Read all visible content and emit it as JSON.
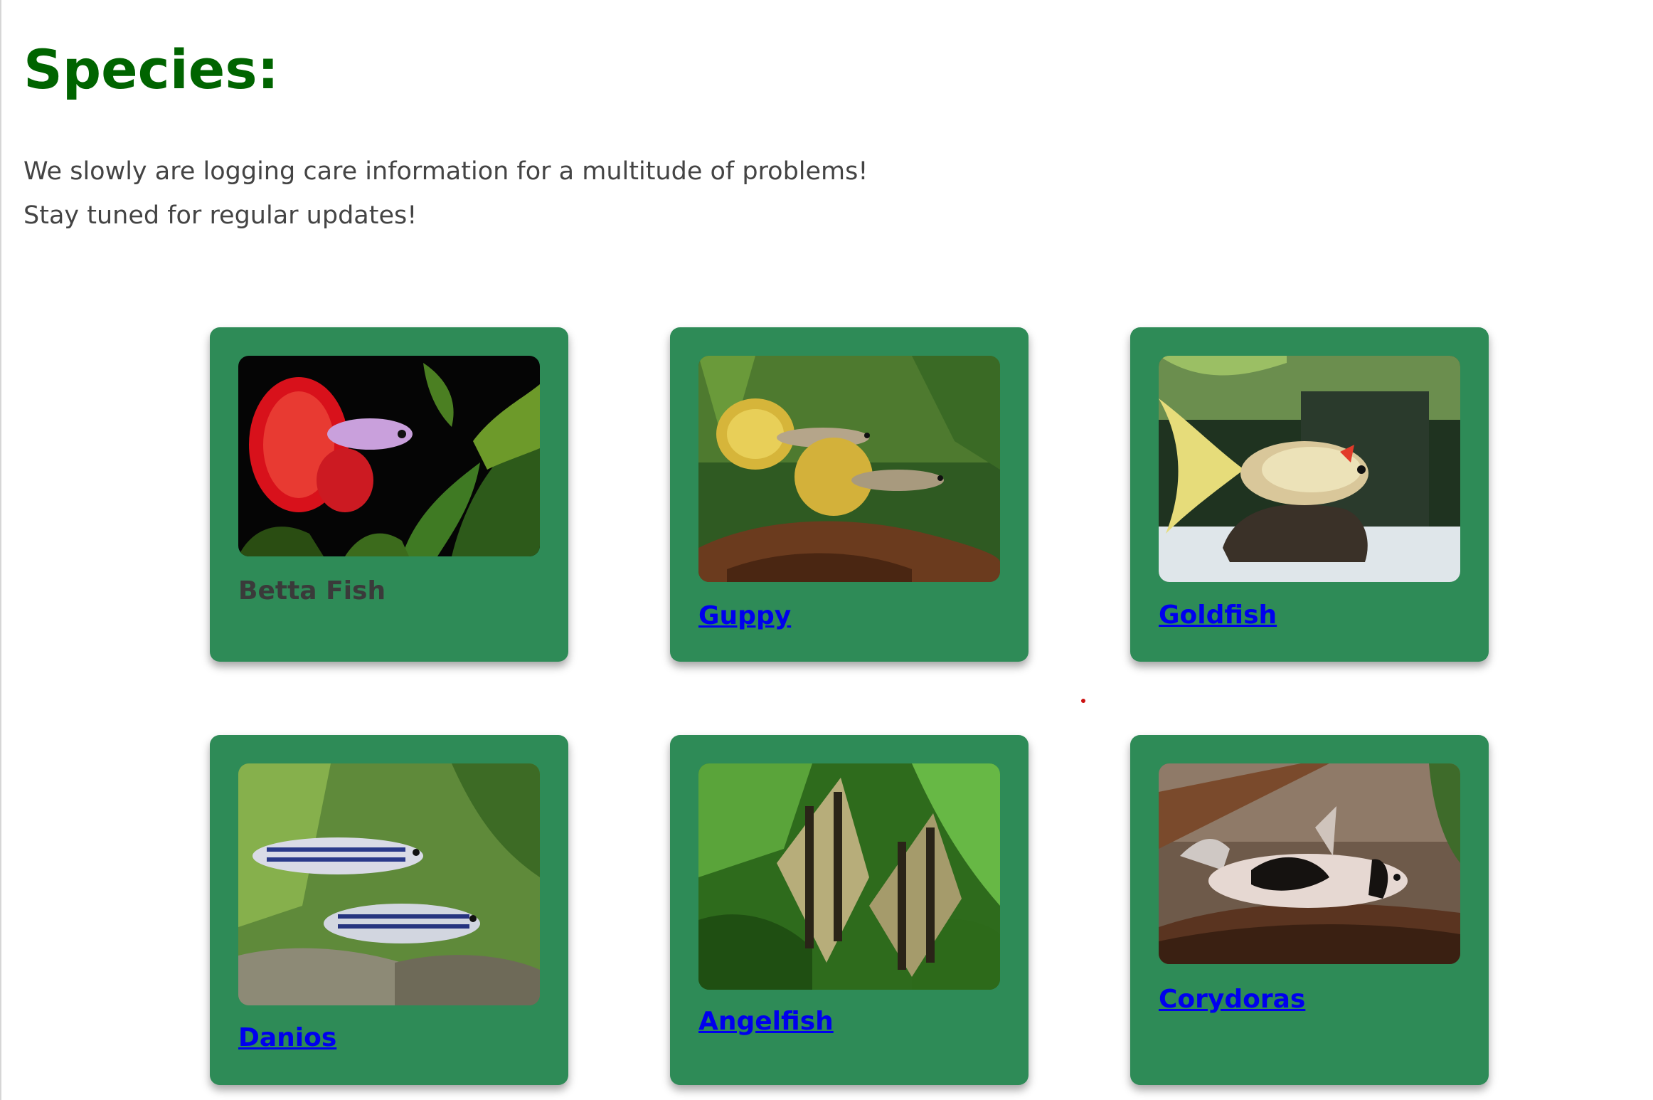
{
  "page": {
    "title": "Species:",
    "intro_lines": [
      "We slowly are logging care information for a multitude of problems!",
      "Stay tuned for regular updates!"
    ]
  },
  "cards": [
    {
      "name": "Betta Fish",
      "linked": false,
      "image": "betta-fish-photo"
    },
    {
      "name": "Guppy",
      "linked": true,
      "image": "guppy-photo"
    },
    {
      "name": "Goldfish",
      "linked": true,
      "image": "goldfish-photo"
    },
    {
      "name": "Danios",
      "linked": true,
      "image": "danios-photo"
    },
    {
      "name": "Angelfish",
      "linked": true,
      "image": "angelfish-photo"
    },
    {
      "name": "Corydoras",
      "linked": true,
      "image": "corydoras-photo"
    }
  ],
  "colors": {
    "heading": "#006400",
    "card_background": "#2e8b57",
    "link": "#0000ee",
    "body_text": "#444444"
  }
}
